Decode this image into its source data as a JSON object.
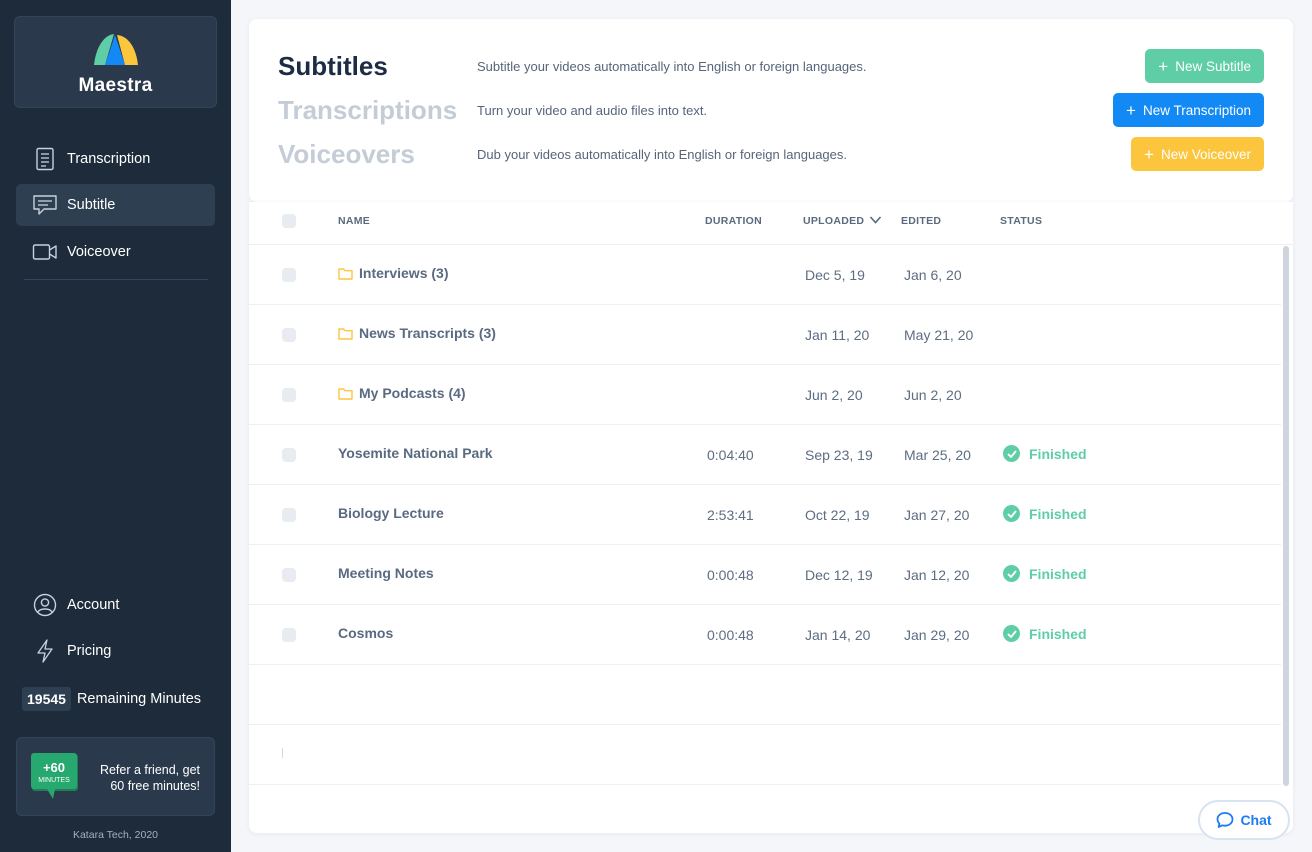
{
  "brand": {
    "name": "Maestra"
  },
  "nav": [
    {
      "label": "Transcription",
      "icon": "document-icon"
    },
    {
      "label": "Subtitle",
      "icon": "subtitle-icon",
      "active": true
    },
    {
      "label": "Voiceover",
      "icon": "video-camera-icon"
    }
  ],
  "bottom_nav": {
    "account": "Account",
    "pricing": "Pricing",
    "minutes_count": "19545",
    "minutes_label": "Remaining Minutes"
  },
  "refer": {
    "badge_value": "+60",
    "badge_unit": "MINUTES",
    "line1": "Refer a friend, get",
    "line2": "60 free minutes!"
  },
  "copyright": "Katara Tech, 2020",
  "header": {
    "rows": [
      {
        "title": "Subtitles",
        "desc": "Subtitle your videos automatically into English or foreign languages.",
        "button": "New Subtitle"
      },
      {
        "title": "Transcriptions",
        "desc": "Turn your video and audio files into text.",
        "button": "New Transcription"
      },
      {
        "title": "Voiceovers",
        "desc": "Dub your videos automatically into English or foreign languages.",
        "button": "New Voiceover"
      }
    ]
  },
  "table": {
    "columns": {
      "name": "NAME",
      "duration": "DURATION",
      "uploaded": "UPLOADED",
      "edited": "EDITED",
      "status": "STATUS"
    },
    "rows": [
      {
        "name": "Interviews (3)",
        "folder": true,
        "duration": "",
        "uploaded": "Dec 5, 19",
        "edited": "Jan 6, 20",
        "status": ""
      },
      {
        "name": "News Transcripts (3)",
        "folder": true,
        "duration": "",
        "uploaded": "Jan 11, 20",
        "edited": "May 21, 20",
        "status": ""
      },
      {
        "name": "My Podcasts (4)",
        "folder": true,
        "duration": "",
        "uploaded": "Jun 2, 20",
        "edited": "Jun 2, 20",
        "status": ""
      },
      {
        "name": "Yosemite National Park",
        "folder": false,
        "duration": "0:04:40",
        "uploaded": "Sep 23, 19",
        "edited": "Mar 25, 20",
        "status": "Finished"
      },
      {
        "name": "Biology Lecture",
        "folder": false,
        "duration": "2:53:41",
        "uploaded": "Oct 22, 19",
        "edited": "Jan 27, 20",
        "status": "Finished"
      },
      {
        "name": "Meeting Notes",
        "folder": false,
        "duration": "0:00:48",
        "uploaded": "Dec 12, 19",
        "edited": "Jan 12, 20",
        "status": "Finished"
      },
      {
        "name": "Cosmos",
        "folder": false,
        "duration": "0:00:48",
        "uploaded": "Jan 14, 20",
        "edited": "Jan 29, 20",
        "status": "Finished"
      }
    ]
  },
  "chat": {
    "label": "Chat"
  },
  "colors": {
    "sidebar": "#1d2b3b",
    "subtitle_button": "#5fcea6",
    "transcription_button": "#1289f4",
    "voiceover_button": "#fcc53e",
    "finished": "#5fcea6"
  }
}
